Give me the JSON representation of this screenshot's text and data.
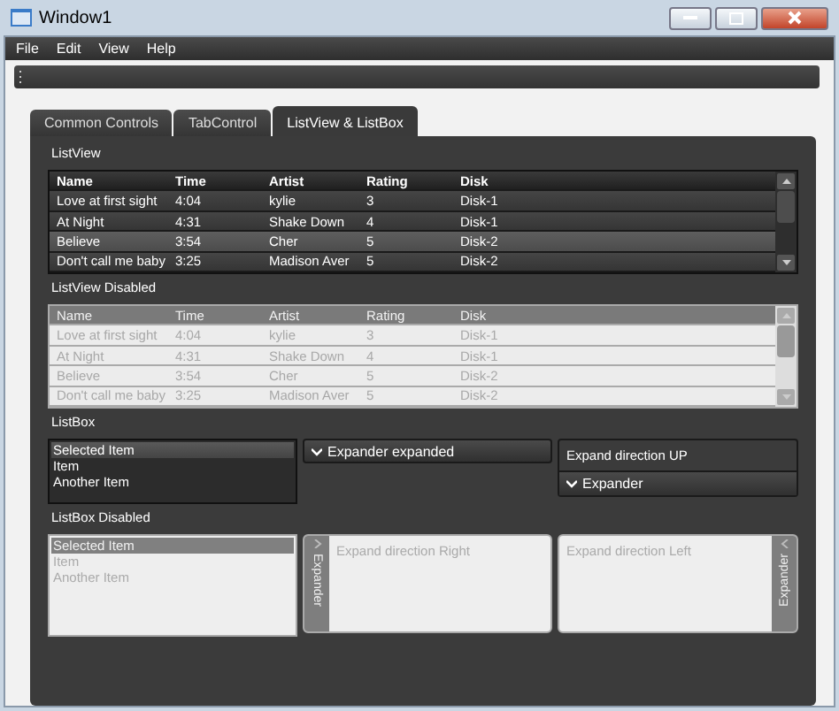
{
  "window": {
    "title": "Window1"
  },
  "menu": [
    "File",
    "Edit",
    "View",
    "Help"
  ],
  "tabs": [
    {
      "label": "Common Controls",
      "selected": false
    },
    {
      "label": "TabControl",
      "selected": false
    },
    {
      "label": "ListView & ListBox",
      "selected": true
    }
  ],
  "listview": {
    "label": "ListView",
    "columns": [
      "Name",
      "Time",
      "Artist",
      "Rating",
      "Disk"
    ],
    "rows": [
      {
        "cells": [
          "Love at first sight",
          "4:04",
          "kylie",
          "3",
          "Disk-1"
        ],
        "selected": false
      },
      {
        "cells": [
          "At Night",
          "4:31",
          "Shake Down",
          "4",
          "Disk-1"
        ],
        "selected": false
      },
      {
        "cells": [
          "Believe",
          "3:54",
          "Cher",
          "5",
          "Disk-2"
        ],
        "selected": true
      },
      {
        "cells": [
          "Don't call me baby",
          "3:25",
          "Madison Aver",
          "5",
          "Disk-2"
        ],
        "selected": false
      }
    ]
  },
  "listview_disabled": {
    "label": "ListView Disabled",
    "columns": [
      "Name",
      "Time",
      "Artist",
      "Rating",
      "Disk"
    ],
    "rows": [
      {
        "cells": [
          "Love at first sight",
          "4:04",
          "kylie",
          "3",
          "Disk-1"
        ]
      },
      {
        "cells": [
          "At Night",
          "4:31",
          "Shake Down",
          "4",
          "Disk-1"
        ]
      },
      {
        "cells": [
          "Believe",
          "3:54",
          "Cher",
          "5",
          "Disk-2"
        ]
      },
      {
        "cells": [
          "Don't call me baby",
          "3:25",
          "Madison Aver",
          "5",
          "Disk-2"
        ]
      }
    ]
  },
  "listbox": {
    "label": "ListBox",
    "items": [
      {
        "text": "Selected Item",
        "selected": true
      },
      {
        "text": "Item",
        "selected": false
      },
      {
        "text": "Another Item",
        "selected": false
      }
    ]
  },
  "expanders": [
    {
      "kind": "down",
      "header": "Expander expanded",
      "expanded": true
    },
    {
      "kind": "up",
      "header": "Expander",
      "content": "Expand direction UP",
      "expanded": true
    }
  ],
  "listbox_disabled": {
    "label": "ListBox Disabled",
    "items": [
      {
        "text": "Selected Item",
        "selected": true
      },
      {
        "text": "Item",
        "selected": false
      },
      {
        "text": "Another Item",
        "selected": false
      }
    ]
  },
  "expanders_disabled": [
    {
      "kind": "right",
      "header": "Expander",
      "content": "Expand direction Right"
    },
    {
      "kind": "left",
      "header": "Expander",
      "content": "Expand direction Left"
    }
  ]
}
